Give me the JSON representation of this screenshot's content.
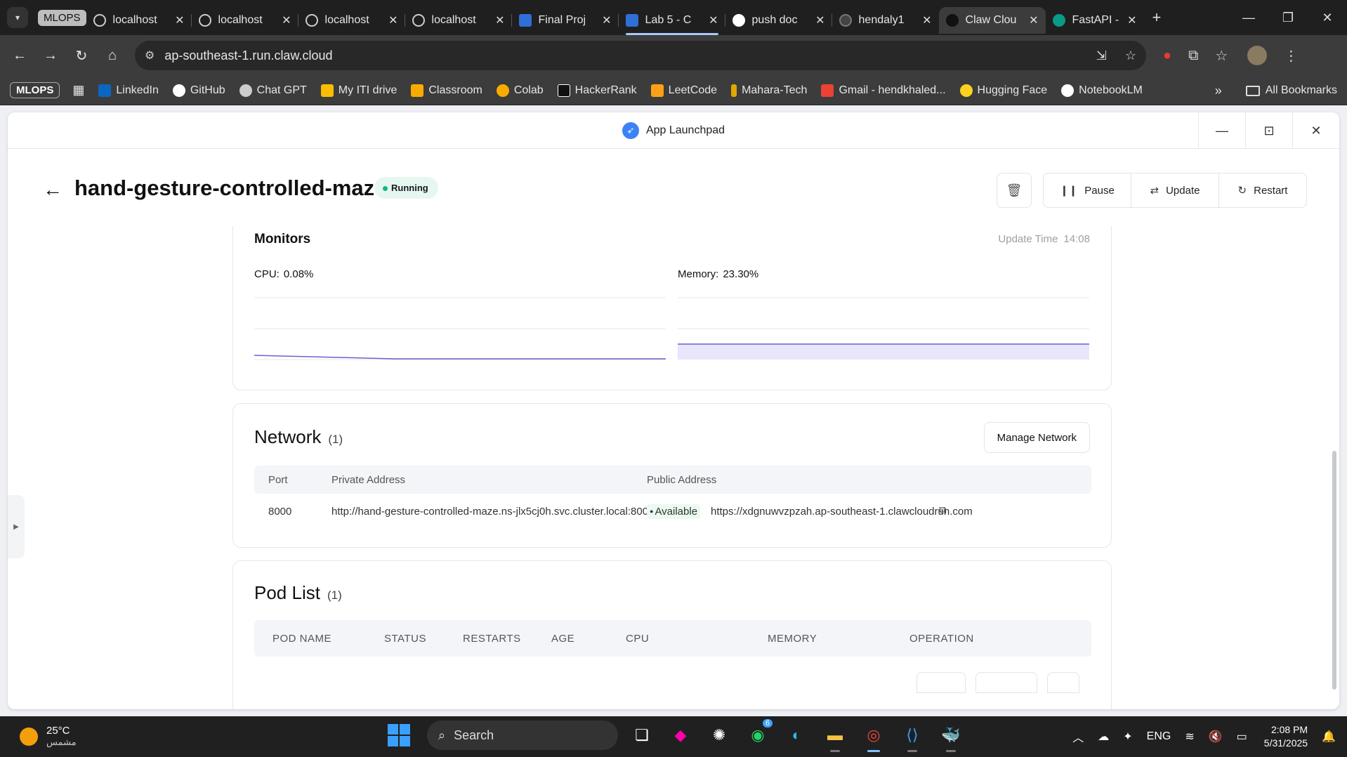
{
  "browser": {
    "tab_group": "MLOPS",
    "tabs": [
      {
        "label": "localhost",
        "icon": "globe-icon"
      },
      {
        "label": "localhost",
        "icon": "globe-icon"
      },
      {
        "label": "localhost",
        "icon": "globe-icon"
      },
      {
        "label": "localhost",
        "icon": "globe-icon"
      },
      {
        "label": "Final Proj",
        "icon": "classroom-icon"
      },
      {
        "label": "Lab 5 - C",
        "icon": "classroom-icon"
      },
      {
        "label": "push doc",
        "icon": "github-icon"
      },
      {
        "label": "hendaly1",
        "icon": "site-icon"
      },
      {
        "label": "Claw Clou",
        "icon": "claw-icon"
      },
      {
        "label": "FastAPI -",
        "icon": "fastapi-icon"
      }
    ],
    "url": "ap-southeast-1.run.claw.cloud",
    "bookmark_chip": "MLOPS",
    "bookmarks": [
      {
        "label": "LinkedIn",
        "color": "#0a66c2"
      },
      {
        "label": "GitHub",
        "color": "#ffffff"
      },
      {
        "label": "Chat GPT",
        "color": "#cccccc"
      },
      {
        "label": "My ITI drive",
        "color": "#fbbc04"
      },
      {
        "label": "Classroom",
        "color": "#f9ab00"
      },
      {
        "label": "Colab",
        "color": "#f9ab00"
      },
      {
        "label": "HackerRank",
        "color": "#111111"
      },
      {
        "label": "LeetCode",
        "color": "#ffa116"
      },
      {
        "label": "Mahara-Tech",
        "color": "#e0a800"
      },
      {
        "label": "Gmail - hendkhaled...",
        "color": "#ea4335"
      },
      {
        "label": "Hugging Face",
        "color": "#ffd21e"
      },
      {
        "label": "NotebookLM",
        "color": "#ffffff"
      }
    ],
    "all_bookmarks": "All Bookmarks"
  },
  "app": {
    "window_title": "App Launchpad",
    "name": "hand-gesture-controlled-maze",
    "status": "Running",
    "actions": {
      "pause": "Pause",
      "update": "Update",
      "restart": "Restart"
    },
    "accent": "#3b82f6",
    "status_color": "#10b981"
  },
  "monitors": {
    "title": "Monitors",
    "update_label": "Update Time",
    "update_time": "14:08",
    "cpu_label": "CPU:",
    "cpu_value": "0.08%",
    "memory_label": "Memory:",
    "memory_value": "23.30%"
  },
  "network": {
    "title": "Network",
    "count": "(1)",
    "manage_label": "Manage Network",
    "columns": [
      "Port",
      "Private Address",
      "Public Address"
    ],
    "rows": [
      {
        "port": "8000",
        "private": "http://hand-gesture-controlled-maze.ns-jlx5cj0h.svc.cluster.local:8000",
        "public_status": "Available",
        "public": "https://xdgnuwvzpzah.ap-southeast-1.clawcloudrun.com"
      }
    ]
  },
  "pods": {
    "title": "Pod List",
    "count": "(1)",
    "columns": [
      "POD NAME",
      "STATUS",
      "RESTARTS",
      "AGE",
      "CPU",
      "MEMORY",
      "OPERATION"
    ]
  },
  "taskbar": {
    "temperature": "25°C",
    "weather": "مشمس",
    "search": "Search",
    "whatsapp_badge": "6",
    "lang": "ENG",
    "time": "2:08 PM",
    "date": "5/31/2025"
  }
}
